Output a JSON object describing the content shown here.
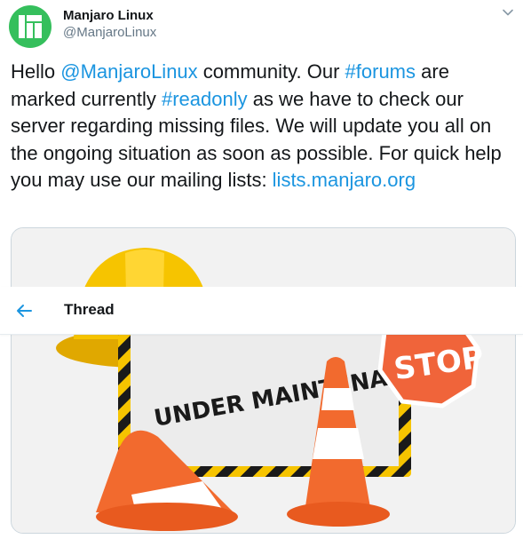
{
  "tweet": {
    "author_name": "Manjaro Linux",
    "author_handle": "@ManjaroLinux",
    "text_parts": [
      {
        "text": "Hello ",
        "link": false
      },
      {
        "text": "@ManjaroLinux",
        "link": true
      },
      {
        "text": " community. Our ",
        "link": false
      },
      {
        "text": "#forums",
        "link": true
      },
      {
        "text": " are marked currently ",
        "link": false
      },
      {
        "text": "#readonly",
        "link": true
      },
      {
        "text": " as we have to check our server regarding missing files. We will update you all on the ongoing situation as soon as possible. For quick help you may use our mailing lists: ",
        "link": false
      },
      {
        "text": "lists.manjaro.org",
        "link": true
      }
    ],
    "media": {
      "sign_text": "UNDER MAINTENANCE",
      "stop_text": "STOP"
    }
  },
  "thread_bar": {
    "title": "Thread"
  },
  "colors": {
    "link": "#1b95e0",
    "manjaro_green": "#35bf5c",
    "cone_orange": "#f26a2e",
    "stop_orange": "#f0643a",
    "helmet_yellow": "#f6c400"
  },
  "icons": {
    "avatar": "manjaro-logo-icon",
    "menu": "chevron-down-icon",
    "back": "back-arrow-icon"
  }
}
